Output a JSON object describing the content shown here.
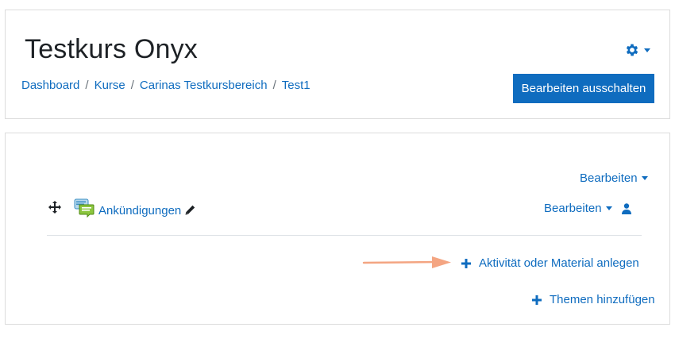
{
  "header": {
    "title": "Testkurs Onyx",
    "breadcrumb": [
      "Dashboard",
      "Kurse",
      "Carinas Testkursbereich",
      "Test1"
    ],
    "breadcrumb_separator": "/",
    "edit_toggle_label": "Bearbeiten ausschalten"
  },
  "section": {
    "edit_menu_label": "Bearbeiten",
    "activity": {
      "name": "Ankündigungen",
      "edit_menu_label": "Bearbeiten"
    },
    "add_activity_label": "Aktivität oder Material anlegen",
    "add_topics_label": "Themen hinzufügen"
  },
  "colors": {
    "link": "#0f6cbf",
    "primary": "#0f6cbf",
    "annotation_arrow": "#f4a582"
  },
  "icons": [
    "gear-icon",
    "move-icon",
    "forum-icon",
    "pencil-icon",
    "user-icon",
    "plus-icon",
    "annotation-arrow-icon"
  ]
}
